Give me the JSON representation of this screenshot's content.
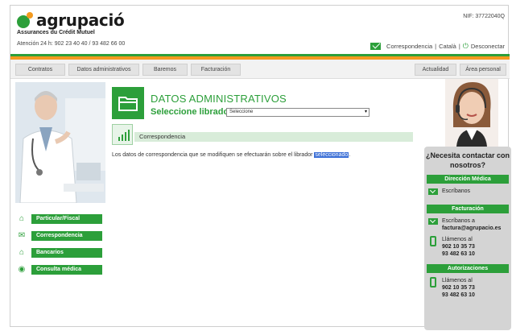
{
  "header": {
    "brand": "agrupació",
    "brand_sub": "Assurances du Crédit Mutuel",
    "hotline": "Atención 24 h: 902 23 40 40 / 93 482 66 00",
    "nif": "NIF: 37722040Q",
    "links": {
      "correspondencia": "Correspondencia",
      "separator1": "|",
      "catala": "Català",
      "separator2": "|",
      "desconectar": "Desconectar"
    }
  },
  "nav": {
    "items": [
      "Contratos",
      "Datos administrativos",
      "Baremos",
      "Facturación"
    ],
    "right_items": [
      "Actualidad",
      "Área personal"
    ]
  },
  "sidebar": {
    "items": [
      {
        "label": "Particular/Fiscal",
        "icon": "home-icon"
      },
      {
        "label": "Correspondencia",
        "icon": "mail-icon"
      },
      {
        "label": "Bancarios",
        "icon": "bank-icon"
      },
      {
        "label": "Consulta médica",
        "icon": "medical-icon"
      }
    ]
  },
  "main": {
    "title": "DATOS ADMINISTRATIVOS",
    "select_label": "Seleccione librador",
    "select_value": "Seleccione",
    "section": "Correspondencia",
    "notice_before": "Los datos de correspondencia que se modifiquen se efectuarán sobre el librador ",
    "notice_highlight": "seleccionado",
    "notice_after": "."
  },
  "contact": {
    "question": "¿Necesita contactar con nosotros?",
    "medical": {
      "title": "Dirección Médica",
      "write": "Escríbanos"
    },
    "billing": {
      "title": "Facturación",
      "write": "Escríbanos a",
      "email": "factura@agrupacio.es",
      "call": "Llámenos al",
      "phone1": "902 10 35 73",
      "phone2": "93 482 63 10"
    },
    "auth": {
      "title": "Autorizaciones",
      "call": "Llámenos al",
      "phone1": "902 10 35 73",
      "phone2": "93 482 63 10"
    }
  },
  "colors": {
    "brand_green": "#2c9f3a",
    "brand_orange": "#f39a1f",
    "highlight": "#3b6fd6"
  }
}
